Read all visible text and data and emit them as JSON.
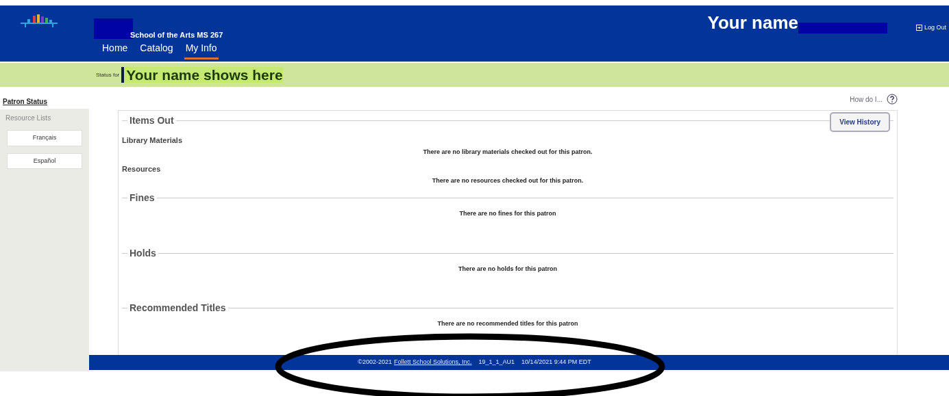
{
  "header": {
    "school_name": "School of the Arts MS 267",
    "nav": [
      {
        "label": "Home",
        "selected": false
      },
      {
        "label": "Catalog",
        "selected": false
      },
      {
        "label": "My Info",
        "selected": true
      }
    ],
    "user_name": "Your name",
    "logout": "Log Out"
  },
  "status_bar": {
    "label": "Status for",
    "name": "Your name shows here"
  },
  "sidebar": {
    "items": [
      {
        "label": "Patron Status",
        "selected": true
      },
      {
        "label": "Resource Lists",
        "selected": false
      }
    ],
    "language_buttons": [
      "Français",
      "Español"
    ]
  },
  "help_link": "How do I...",
  "sections": [
    {
      "title": "Items Out",
      "button": "View History",
      "groups": [
        {
          "heading": "Library Materials",
          "message": "There are no library materials checked out for this patron."
        },
        {
          "heading": "Resources",
          "message": "There are no resources checked out for this patron."
        }
      ]
    },
    {
      "title": "Fines",
      "message": "There are no fines for this patron"
    },
    {
      "title": "Holds",
      "message": "There are no holds for this patron"
    },
    {
      "title": "Recommended Titles",
      "message": "There are no recommended titles for this patron"
    }
  ],
  "footer": {
    "copyright": "©2002-2021",
    "link": "Follett School Solutions, Inc.",
    "version": "19_1_1_AU1",
    "timestamp": "10/14/2021 9:44 PM EDT"
  },
  "annotations": [
    {
      "kind": "ellipse"
    }
  ]
}
